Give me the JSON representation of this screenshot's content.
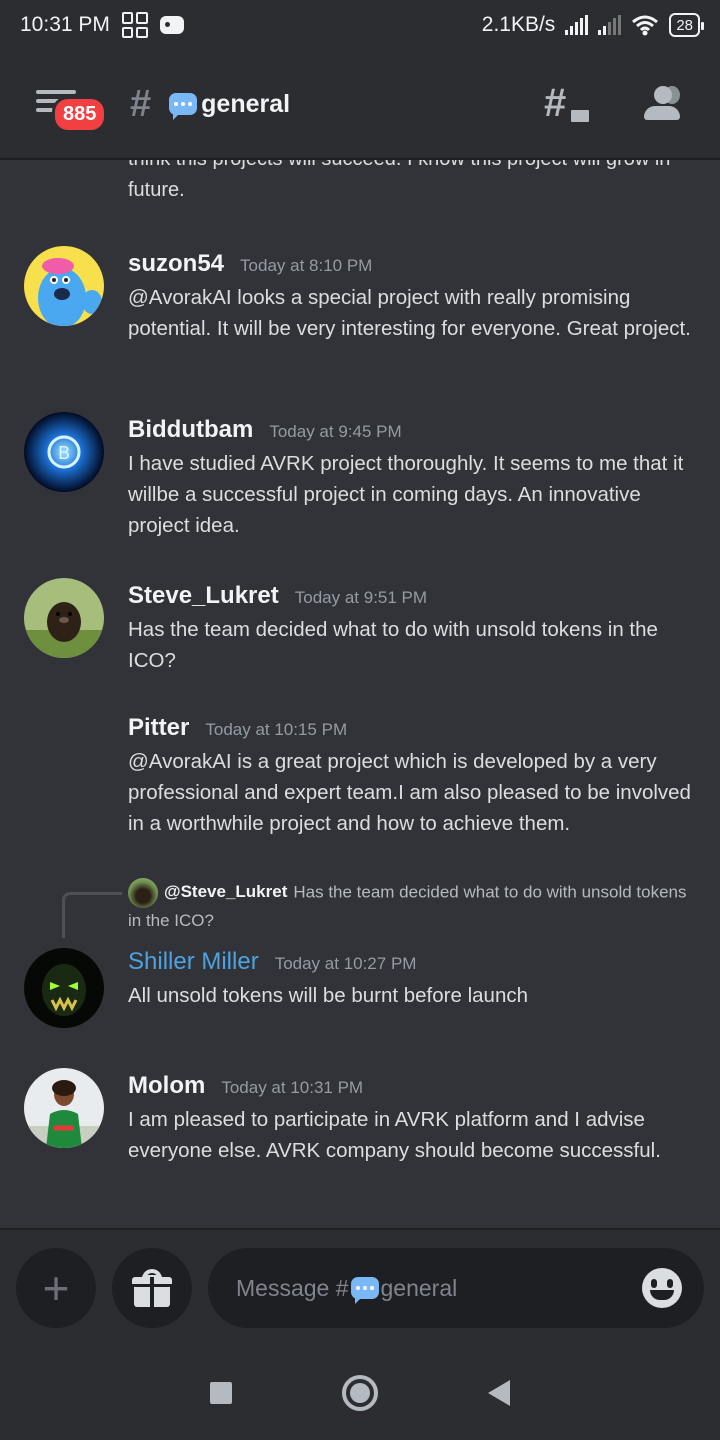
{
  "status_bar": {
    "time": "10:31 PM",
    "network_speed": "2.1KB/s",
    "battery": "28",
    "icons": [
      "grid-app-icon",
      "game-controller-icon",
      "signal-icon",
      "signal-icon",
      "wifi-icon",
      "battery-icon"
    ]
  },
  "header": {
    "unread_badge": "885",
    "channel_name": "general",
    "channel_emoji": "speech-balloon",
    "icons": [
      "menu-icon",
      "hash-icon",
      "threads-icon",
      "members-icon"
    ]
  },
  "messages": [
    {
      "partial_text": "think this projects will succeed. I know this project will grow in future."
    },
    {
      "username": "suzon54",
      "timestamp": "Today at 8:10 PM",
      "text": "@AvorakAI looks a special project with really promising potential. It will be very interesting for everyone. Great project."
    },
    {
      "username": "Biddutbam",
      "timestamp": "Today at 9:45 PM",
      "text": "I have studied AVRK project thoroughly. It seems to me that it willbe a successful project in coming days. An innovative project idea."
    },
    {
      "username": "Steve_Lukret",
      "timestamp": "Today at 9:51 PM",
      "text": "Has the team decided what to do with unsold tokens in the ICO?"
    },
    {
      "username": "Pitter",
      "timestamp": "Today at 10:15 PM",
      "text": "@AvorakAI  is a great project which is developed by a very professional and expert team.I am also pleased to be involved in a worthwhile project and how to achieve them."
    },
    {
      "reply_mention": "@Steve_Lukret",
      "reply_text": "Has the team decided what to do with unsold tokens in the ICO?",
      "username": "Shiller Miller",
      "timestamp": "Today at 10:27 PM",
      "text": "All unsold tokens will be burnt before launch"
    },
    {
      "username": "Molom",
      "timestamp": "Today at 10:31 PM",
      "text": "I am pleased to participate in AVRK platform and I advise everyone else. AVRK company should become successful."
    }
  ],
  "composer": {
    "placeholder_prefix": "Message #",
    "placeholder_channel": "general",
    "icons": [
      "plus-icon",
      "gift-icon",
      "emoji-icon"
    ]
  },
  "colors": {
    "background": "#313338",
    "header": "#2b2d31",
    "badge": "#f23f42",
    "role_blue": "#4ca3e0"
  }
}
